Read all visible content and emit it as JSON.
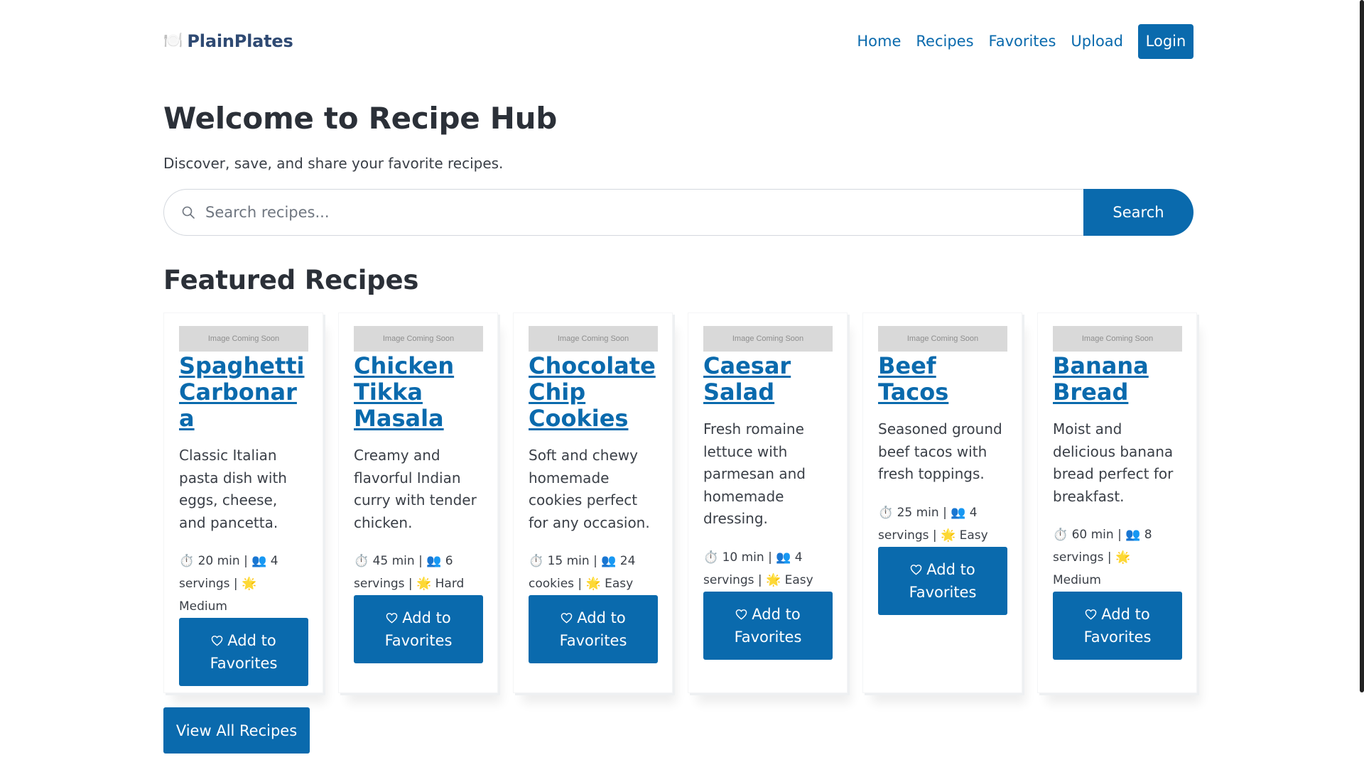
{
  "brand": {
    "icon": "plate-cutlery-icon",
    "name": "PlainPlates"
  },
  "nav": {
    "items": [
      {
        "label": "Home"
      },
      {
        "label": "Recipes"
      },
      {
        "label": "Favorites"
      },
      {
        "label": "Upload"
      }
    ],
    "login_label": "Login"
  },
  "hero": {
    "title": "Welcome to Recipe Hub",
    "subtitle": "Discover, save, and share your favorite recipes."
  },
  "search": {
    "placeholder": "Search recipes...",
    "value": "",
    "button_label": "Search"
  },
  "featured": {
    "title": "Featured Recipes",
    "image_placeholder": "Image Coming Soon",
    "favorite_label": "Add to Favorites",
    "recipes": [
      {
        "title": "Spaghetti Carbonara",
        "description": "Classic Italian pasta dish with eggs, cheese, and pancetta.",
        "meta": "⏱️ 20 min | 👥 4 servings | 🌟 Medium"
      },
      {
        "title": "Chicken Tikka Masala",
        "description": "Creamy and flavorful Indian curry with tender chicken.",
        "meta": "⏱️ 45 min | 👥 6 servings | 🌟 Hard"
      },
      {
        "title": "Chocolate Chip Cookies",
        "description": "Soft and chewy homemade cookies perfect for any occasion.",
        "meta": "⏱️ 15 min | 👥 24 cookies | 🌟 Easy"
      },
      {
        "title": "Caesar Salad",
        "description": "Fresh romaine lettuce with parmesan and homemade dressing.",
        "meta": "⏱️ 10 min | 👥 4 servings | 🌟 Easy"
      },
      {
        "title": "Beef Tacos",
        "description": "Seasoned ground beef tacos with fresh toppings.",
        "meta": "⏱️ 25 min | 👥 4 servings | 🌟 Easy"
      },
      {
        "title": "Banana Bread",
        "description": "Moist and delicious banana bread perfect for breakfast.",
        "meta": "⏱️ 60 min | 👥 8 servings | 🌟 Medium"
      }
    ],
    "view_all_label": "View All Recipes"
  },
  "colors": {
    "accent": "#0a6aad",
    "brand_text": "#2f4a73",
    "heading": "#2b3038"
  }
}
